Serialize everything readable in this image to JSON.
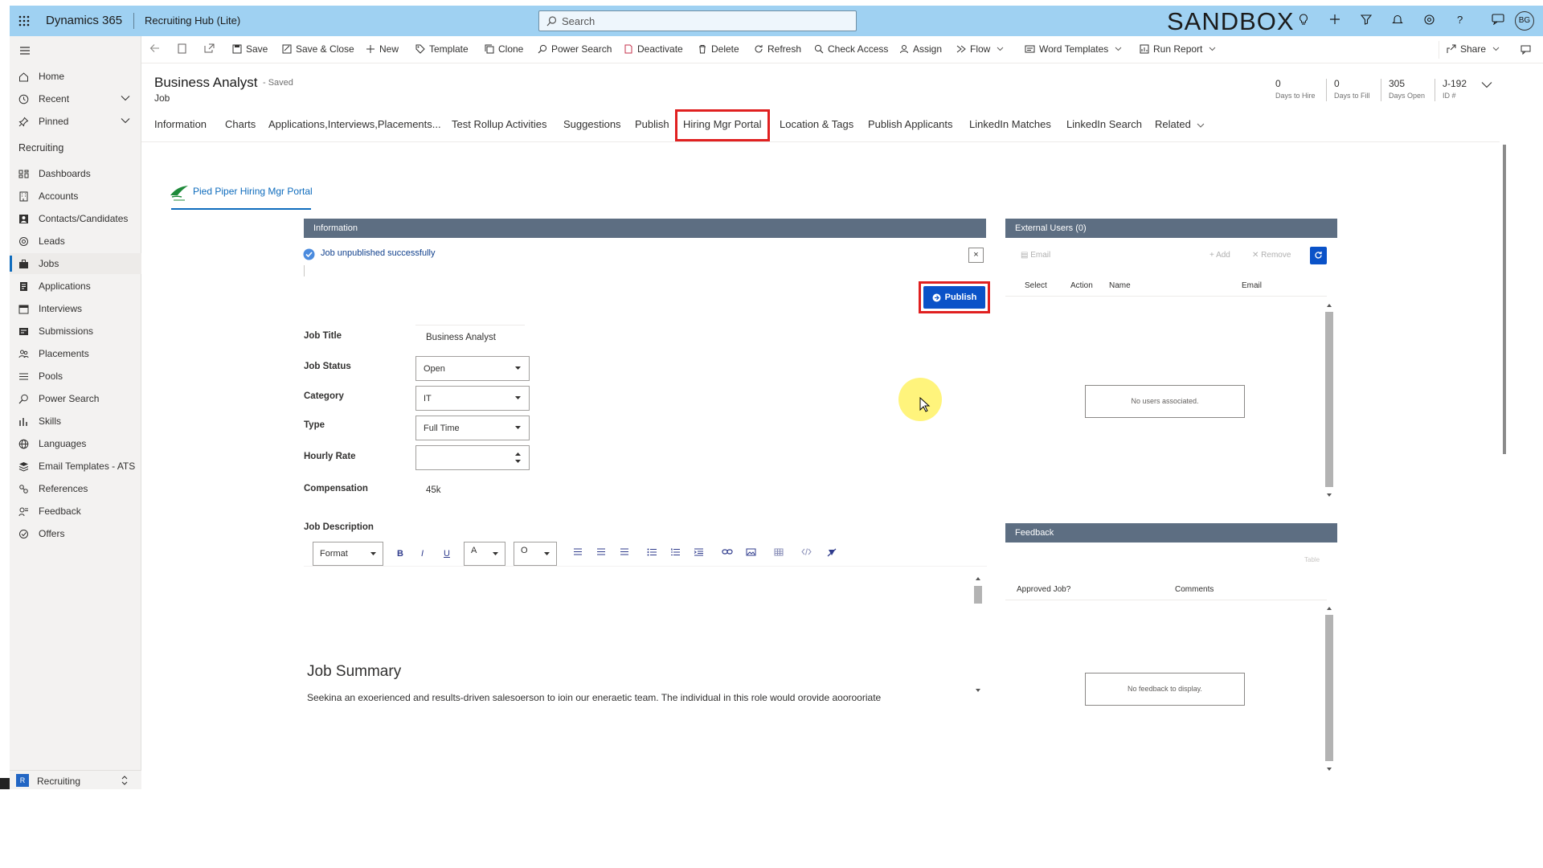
{
  "topbar": {
    "app_name": "Dynamics 365",
    "hub_name": "Recruiting Hub (Lite)",
    "search_placeholder": "Search",
    "env_label": "SANDBOX",
    "user_initials": "BG",
    "bar_color": "#9fd1f2"
  },
  "nav": {
    "items_top": [
      {
        "label": "Home",
        "icon": "home-icon"
      },
      {
        "label": "Recent",
        "icon": "clock-icon"
      },
      {
        "label": "Pinned",
        "icon": "pin-icon"
      }
    ],
    "group_label": "Recruiting",
    "items": [
      {
        "label": "Dashboards",
        "icon": "dashboard-icon"
      },
      {
        "label": "Accounts",
        "icon": "building-icon"
      },
      {
        "label": "Contacts/Candidates",
        "icon": "contacts-icon"
      },
      {
        "label": "Leads",
        "icon": "leads-icon"
      },
      {
        "label": "Jobs",
        "icon": "briefcase-icon"
      },
      {
        "label": "Applications",
        "icon": "document-icon"
      },
      {
        "label": "Interviews",
        "icon": "calendar-icon"
      },
      {
        "label": "Submissions",
        "icon": "submission-icon"
      },
      {
        "label": "Placements",
        "icon": "people-icon"
      },
      {
        "label": "Pools",
        "icon": "pool-icon"
      },
      {
        "label": "Power Search",
        "icon": "search-icon"
      },
      {
        "label": "Skills",
        "icon": "skills-icon"
      },
      {
        "label": "Languages",
        "icon": "globe-icon"
      },
      {
        "label": "Email Templates - ATS",
        "icon": "stack-icon"
      },
      {
        "label": "References",
        "icon": "reference-icon"
      },
      {
        "label": "Feedback",
        "icon": "feedback-icon"
      },
      {
        "label": "Offers",
        "icon": "offer-icon"
      }
    ],
    "area_badge": "R",
    "area_label": "Recruiting"
  },
  "commands": {
    "save": "Save",
    "save_close": "Save & Close",
    "new": "New",
    "template": "Template",
    "clone": "Clone",
    "power_search": "Power Search",
    "deactivate": "Deactivate",
    "delete": "Delete",
    "refresh": "Refresh",
    "check_access": "Check Access",
    "assign": "Assign",
    "flow": "Flow",
    "word_templates": "Word Templates",
    "run_report": "Run Report",
    "share": "Share"
  },
  "record": {
    "title": "Business Analyst",
    "saved_status": "- Saved",
    "entity": "Job",
    "kpis": [
      {
        "value": "0",
        "label": "Days to Hire"
      },
      {
        "value": "0",
        "label": "Days to Fill"
      },
      {
        "value": "305",
        "label": "Days Open"
      },
      {
        "value": "J-192",
        "label": "ID #"
      }
    ]
  },
  "tabs": [
    "Information",
    "Charts",
    "Applications,Interviews,Placements...",
    "Test Rollup Activities",
    "Suggestions",
    "Publish",
    "Hiring Mgr Portal",
    "Location & Tags",
    "Publish Applicants",
    "LinkedIn Matches",
    "LinkedIn Search",
    "Related"
  ],
  "active_tab": "Hiring Mgr Portal",
  "portal": {
    "tab_label": "Pied Piper Hiring Mgr Portal",
    "info_header": "Information",
    "message": "Job unpublished successfully",
    "close_label": "×",
    "publish_label": "Publish",
    "fields": {
      "job_title_label": "Job Title",
      "job_title_value": "Business Analyst",
      "job_status_label": "Job Status",
      "job_status_value": "Open",
      "category_label": "Category",
      "category_value": "IT",
      "type_label": "Type",
      "type_value": "Full Time",
      "hourly_rate_label": "Hourly Rate",
      "hourly_rate_value": "",
      "compensation_label": "Compensation",
      "compensation_value": "45k",
      "job_description_label": "Job Description"
    },
    "rte": {
      "format_label": "Format",
      "font_color_label": "A",
      "bg_color_label": "O"
    },
    "summary_heading": "Job Summary",
    "summary_text": "Seekina an exoerienced and results-driven salesoerson to ioin our eneraetic team. The individual in this role would orovide aoorooriate"
  },
  "external_users": {
    "header": "External Users (0)",
    "email_label": "Email",
    "add_label": "Add",
    "remove_label": "Remove",
    "columns": [
      "Select",
      "Action",
      "Name",
      "Email"
    ],
    "empty_text": "No users associated."
  },
  "feedback": {
    "header": "Feedback",
    "toolbar_text": "Table",
    "columns": [
      "Approved Job?",
      "Comments"
    ],
    "empty_text": "No feedback to display."
  },
  "colors": {
    "accent": "#0f6cbd",
    "publish_button": "#0a52c8",
    "highlight_box": "#e02020",
    "panel_header": "#5d6e82"
  }
}
